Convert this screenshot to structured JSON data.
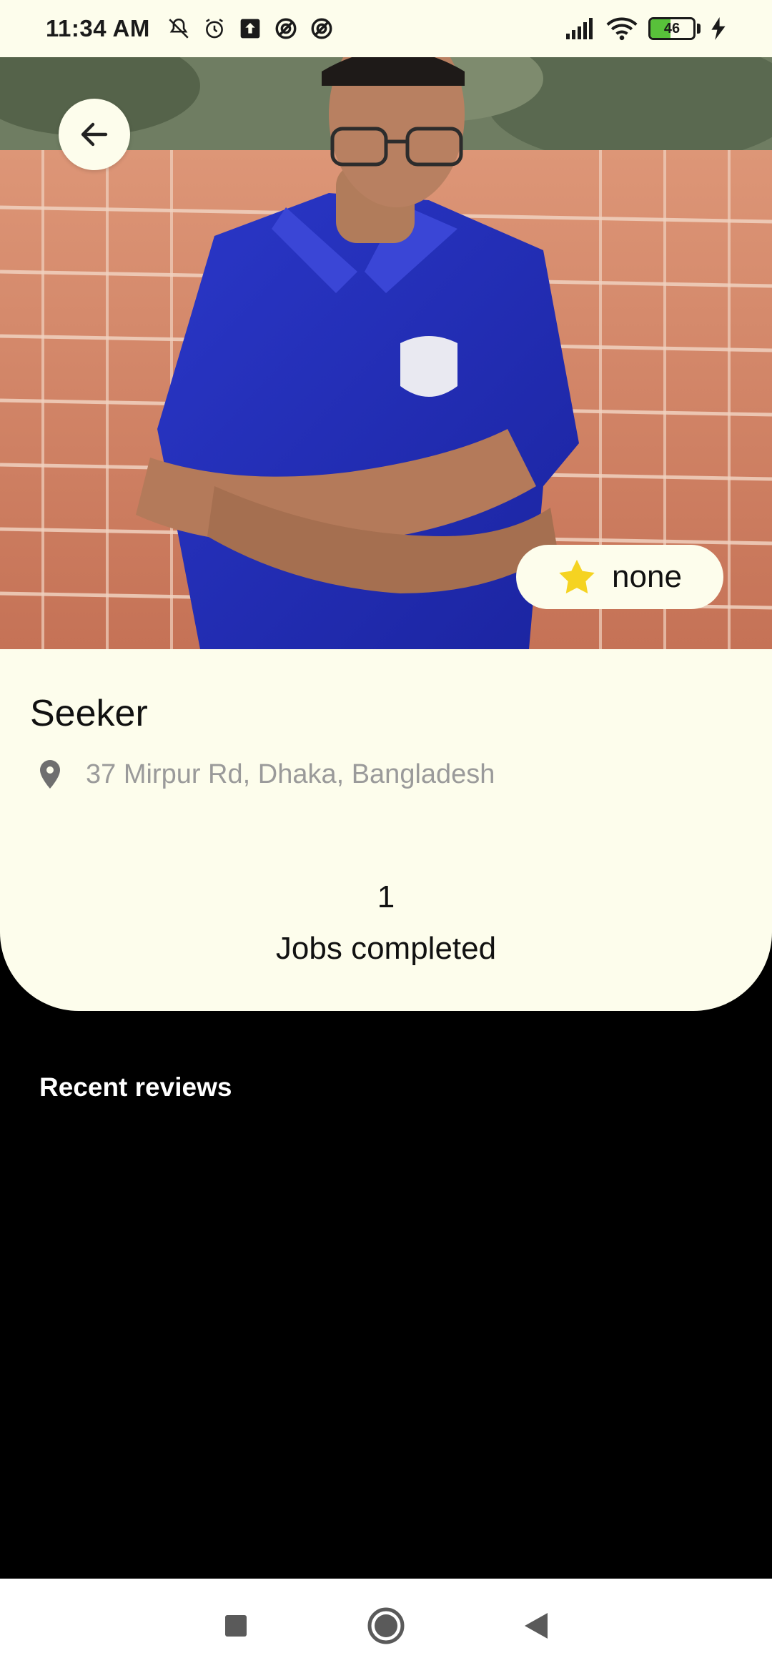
{
  "status_bar": {
    "time": "11:34 AM",
    "battery_level": "46",
    "battery_fraction": 0.46,
    "left_icons": [
      "mute-icon",
      "alarm-icon",
      "upload-icon",
      "sync-icon",
      "sync-icon"
    ],
    "right_icons": [
      "signal-icon",
      "wifi-icon",
      "battery-icon",
      "charging-icon"
    ]
  },
  "hero": {
    "image": "profile-photo",
    "back_icon": "arrow-left-icon",
    "rating": {
      "icon": "star-icon",
      "value": "none"
    }
  },
  "profile": {
    "name": "Seeker",
    "location_icon": "location-pin-icon",
    "location": "37 Mirpur Rd, Dhaka, Bangladesh",
    "jobs_completed_value": "1",
    "jobs_completed_label": "Jobs completed"
  },
  "reviews": {
    "heading": "Recent reviews"
  },
  "nav_bar": {
    "buttons": [
      "recents-icon",
      "home-icon",
      "back-icon"
    ]
  },
  "colors": {
    "card_bg": "#fdfdec",
    "page_bg": "#000000",
    "muted_text": "#9a9a9a",
    "star": "#f5d321",
    "battery_green": "#58c13a"
  }
}
